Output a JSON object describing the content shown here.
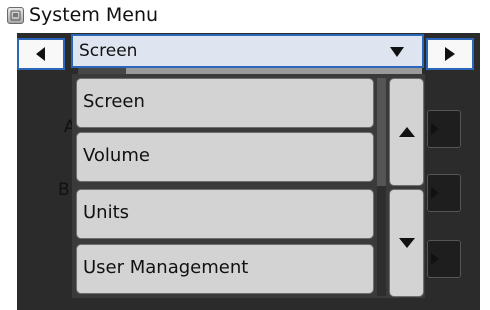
{
  "window": {
    "title": "System Menu",
    "icon": "system-menu-icon"
  },
  "navigation": {
    "prev_icon": "triangle-left-icon",
    "next_icon": "triangle-right-icon"
  },
  "dropdown": {
    "selected": "Screen",
    "caret_icon": "triangle-down-icon",
    "position_fraction": 0.14
  },
  "menu": {
    "items": [
      {
        "label": "Screen"
      },
      {
        "label": "Volume"
      },
      {
        "label": "Units"
      },
      {
        "label": "User Management"
      }
    ],
    "scroll_up_icon": "triangle-up-icon",
    "scroll_down_icon": "triangle-down-icon"
  },
  "background": {
    "letters": [
      "A",
      "B"
    ]
  },
  "colors": {
    "selection_border": "#2b66b8",
    "item_bg": "#d3d3d3",
    "panel_bg": "#2b2b2b"
  }
}
